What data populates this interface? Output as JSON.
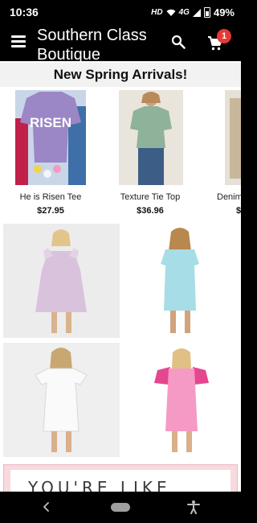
{
  "status_bar": {
    "time": "10:36",
    "network": "HD",
    "signal": "4G",
    "battery_percent": "49%"
  },
  "app_bar": {
    "title": "Southern Class Boutique",
    "cart_count": "1",
    "icons": [
      "menu-icon",
      "search-icon",
      "cart-icon"
    ]
  },
  "section": {
    "title": "New Spring Arrivals!"
  },
  "products": [
    {
      "name": "He is Risen Tee",
      "price": "$27.95"
    },
    {
      "name": "Texture Tie Top",
      "price": "$36.96"
    },
    {
      "name": "Denim",
      "price": "$"
    }
  ],
  "risen_print": "RISEN",
  "promo": {
    "text": "YOU'RE LIKE"
  },
  "colors": {
    "bar_background": "#000000",
    "badge": "#e53935",
    "promo_border": "#f7d9de"
  }
}
